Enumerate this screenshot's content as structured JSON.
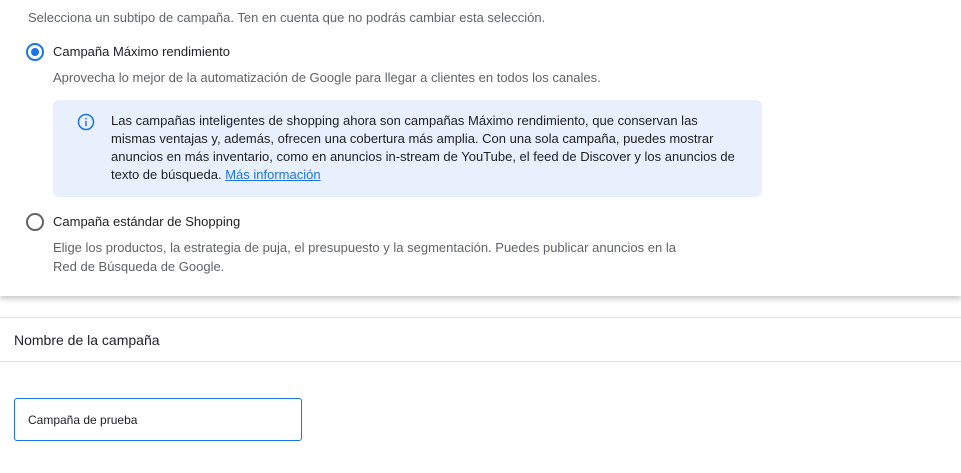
{
  "subtype": {
    "intro": "Selecciona un subtipo de campaña. Ten en cuenta que no podrás cambiar esta selección.",
    "options": [
      {
        "title": "Campaña Máximo rendimiento",
        "description": "Aprovecha lo mejor de la automatización de Google para llegar a clientes en todos los canales.",
        "selected": true
      },
      {
        "title": "Campaña estándar de Shopping",
        "description": "Elige los productos, la estrategia de puja, el presupuesto y la segmentación. Puedes publicar anuncios en la Red de Búsqueda de Google.",
        "selected": false
      }
    ],
    "info": {
      "icon": "info-icon",
      "text": "Las campañas inteligentes de shopping ahora son campañas Máximo rendimiento, que conservan las mismas ventajas y, además, ofrecen una cobertura más amplia. Con una sola campaña, puedes mostrar anuncios en más inventario, como en anuncios in-stream de YouTube, el feed de Discover y los anuncios de texto de búsqueda.",
      "link": "Más información"
    }
  },
  "campaign_name": {
    "title": "Nombre de la campaña",
    "value": "Campaña de prueba"
  },
  "colors": {
    "accent": "#1a73e8",
    "info_background": "#e8f0fe",
    "secondary_text": "#5f6368"
  }
}
